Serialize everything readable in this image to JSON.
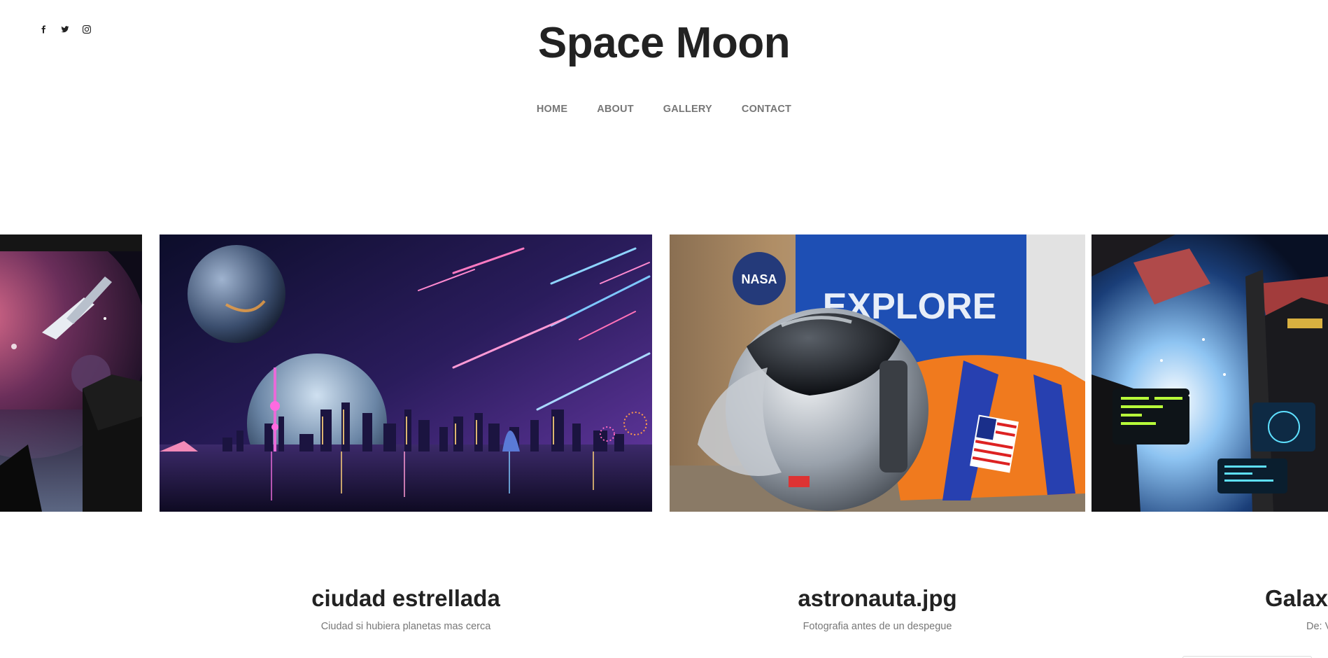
{
  "site": {
    "title": "Space Moon"
  },
  "social": {
    "icons": [
      "facebook-icon",
      "twitter-icon",
      "instagram-icon"
    ]
  },
  "nav": {
    "items": [
      {
        "label": "HOME"
      },
      {
        "label": "ABOUT"
      },
      {
        "label": "GALLERY"
      },
      {
        "label": "CONTACT"
      }
    ]
  },
  "slides": [
    {
      "title": "ciudad estrellada",
      "subtitle": "Ciudad si hubiera planetas mas cerca"
    },
    {
      "title": "astronauta.jpg",
      "subtitle": "Fotografia antes de un despegue"
    },
    {
      "title": "Galax",
      "subtitle": "De: V"
    }
  ],
  "colors": {
    "title": "#222222",
    "nav": "#777777",
    "caption_sub": "#777777"
  }
}
